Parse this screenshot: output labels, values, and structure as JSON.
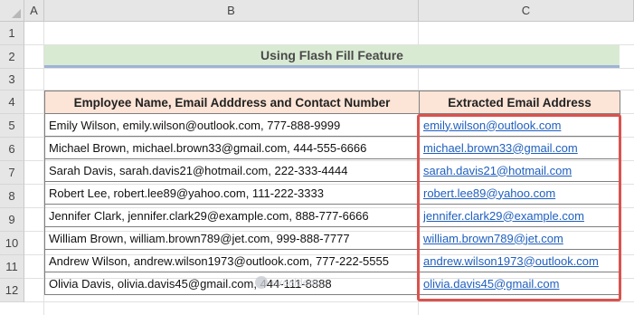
{
  "columns": [
    "A",
    "B",
    "C"
  ],
  "rows": [
    "1",
    "2",
    "3",
    "4",
    "5",
    "6",
    "7",
    "8",
    "9",
    "10",
    "11",
    "12"
  ],
  "title": "Using Flash Fill Feature",
  "table": {
    "headers": [
      "Employee Name, Email Adddress and Contact Number",
      "Extracted Email Address"
    ],
    "rows": [
      {
        "source": "Emily Wilson, emily.wilson@outlook.com, 777-888-9999",
        "email": "emily.wilson@outlook.com"
      },
      {
        "source": "Michael Brown, michael.brown33@gmail.com, 444-555-6666",
        "email": "michael.brown33@gmail.com"
      },
      {
        "source": "Sarah Davis, sarah.davis21@hotmail.com, 222-333-4444",
        "email": "sarah.davis21@hotmail.com"
      },
      {
        "source": "Robert Lee, robert.lee89@yahoo.com, 111-222-3333",
        "email": "robert.lee89@yahoo.com"
      },
      {
        "source": "Jennifer Clark, jennifer.clark29@example.com, 888-777-6666",
        "email": "jennifer.clark29@example.com"
      },
      {
        "source": "William Brown, william.brown789@jet.com, 999-888-7777",
        "email": "william.brown789@jet.com"
      },
      {
        "source": "Andrew Wilson, andrew.wilson1973@outlook.com, 777-222-5555",
        "email": "andrew.wilson1973@outlook.com"
      },
      {
        "source": "Olivia Davis, olivia.davis45@gmail.com, 444-111-8888",
        "email": "olivia.davis45@gmail.com"
      }
    ]
  },
  "watermark": "exceldemy",
  "colors": {
    "title_fill": "#d9ead3",
    "header_fill": "#fce4d6",
    "highlight_border": "#d9534f",
    "link": "#1f5fbf"
  }
}
